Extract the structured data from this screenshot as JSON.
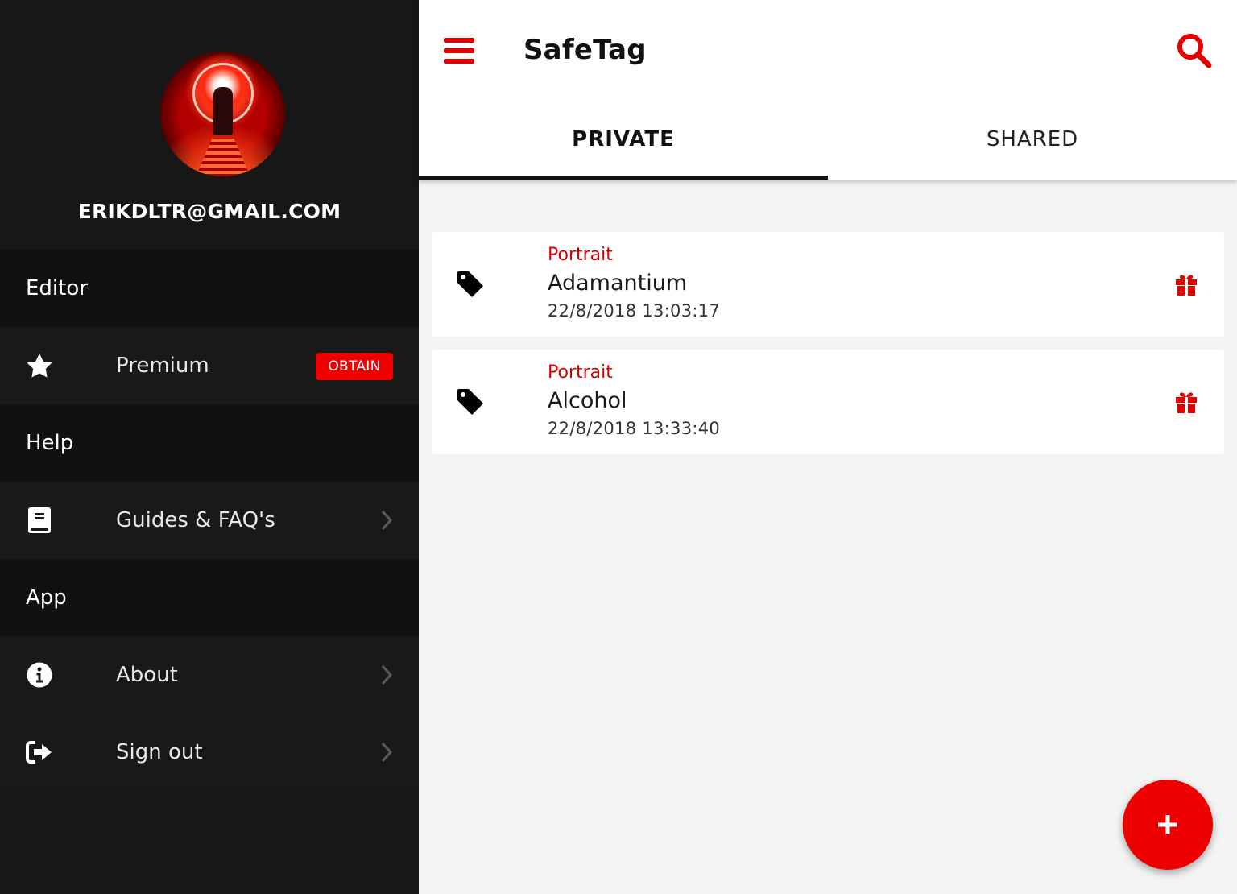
{
  "sidebar": {
    "avatar_icon": "user-avatar-image",
    "email": "ERIKDLTR@GMAIL.COM",
    "sections": [
      {
        "header": "Editor",
        "items": [
          {
            "label": "Premium",
            "icon": "star-icon",
            "badge": "OBTAIN"
          }
        ]
      },
      {
        "header": "Help",
        "items": [
          {
            "label": "Guides & FAQ's",
            "icon": "book-icon"
          }
        ]
      },
      {
        "header": "App",
        "items": [
          {
            "label": "About",
            "icon": "info-icon"
          },
          {
            "label": "Sign out",
            "icon": "sign-out-icon"
          }
        ]
      }
    ]
  },
  "header": {
    "title": "SafeTag",
    "menu_icon": "hamburger-menu-icon",
    "search_icon": "search-icon"
  },
  "tabs": [
    {
      "label": "PRIVATE",
      "active": true
    },
    {
      "label": "SHARED",
      "active": false
    }
  ],
  "tags": [
    {
      "category": "Portrait",
      "name": "Adamantium",
      "date": "22/8/2018 13:03:17",
      "icon": "tag-icon",
      "action_icon": "gift-icon"
    },
    {
      "category": "Portrait",
      "name": "Alcohol",
      "date": "22/8/2018 13:33:40",
      "icon": "tag-icon",
      "action_icon": "gift-icon"
    }
  ],
  "fab": {
    "label": "+",
    "icon": "plus-icon"
  },
  "colors": {
    "accent": "#ee0000",
    "sidebar_bg": "#171717",
    "section_bg": "#111111",
    "content_bg": "#f4f4f4"
  }
}
